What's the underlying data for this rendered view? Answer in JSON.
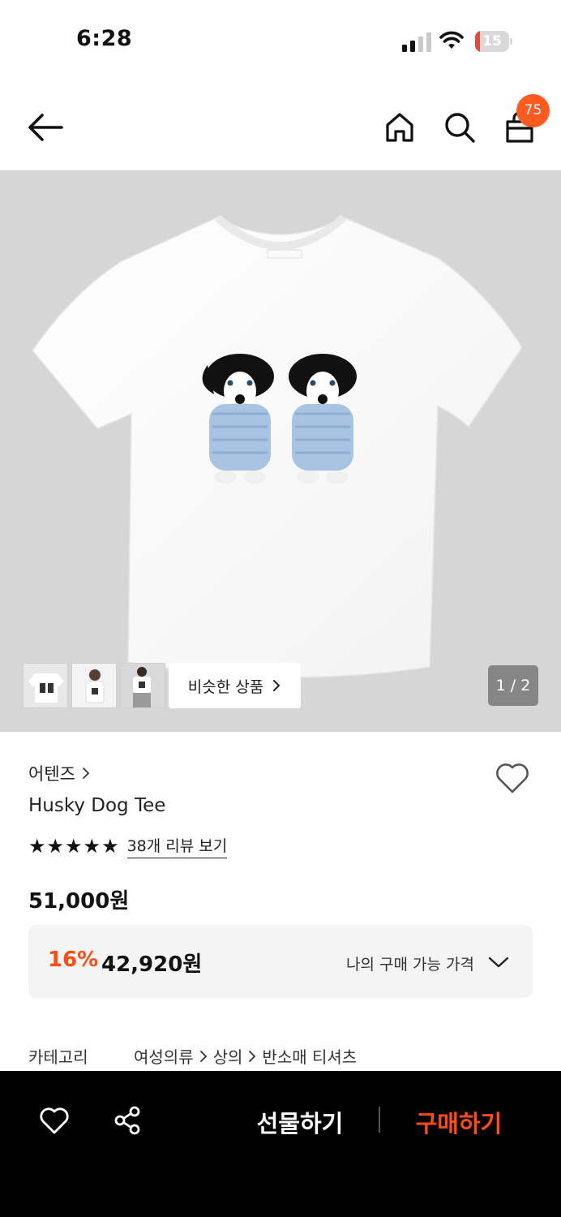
{
  "status_bar": {
    "time": "6:28",
    "battery": "15"
  },
  "header": {
    "cart_count": "75"
  },
  "gallery": {
    "similar_label": "비슷한 상품",
    "page_indicator": "1 / 2"
  },
  "product": {
    "brand": "어텐즈",
    "name": "Husky Dog Tee",
    "rating_stars": 5,
    "review_link": "38개 리뷰 보기",
    "price": "51,000원",
    "discount_rate": "16%",
    "discount_price": "42,920원",
    "my_price_label": "나의 구매 가능 가격"
  },
  "category": {
    "label": "카테고리",
    "path": [
      "여성의류",
      "상의",
      "반소매 티셔츠"
    ]
  },
  "bottom_bar": {
    "gift_label": "선물하기",
    "buy_label": "구매하기"
  },
  "colors": {
    "accent": "#ff4d11",
    "badge": "#ff5a1f",
    "bottom_bar": "#000000"
  }
}
